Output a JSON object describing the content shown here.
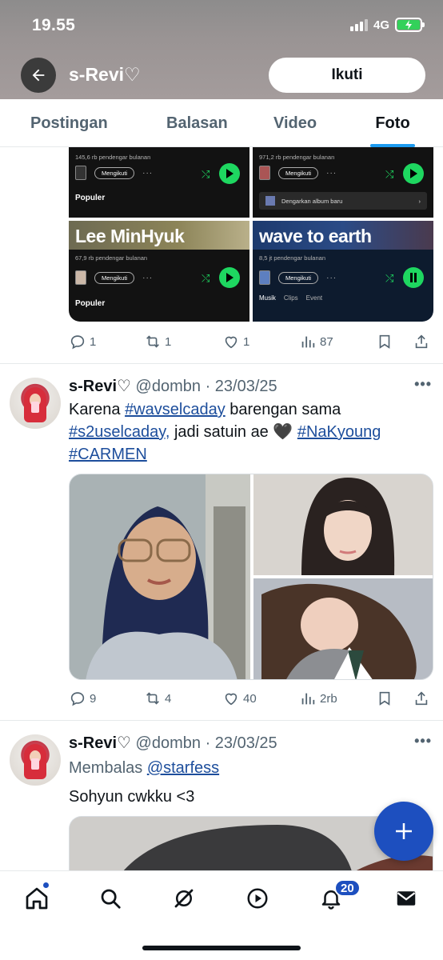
{
  "status_bar": {
    "time": "19.55",
    "network": "4G"
  },
  "header": {
    "profile_name": "s-Revi♡",
    "follow_label": "Ikuti"
  },
  "tabs": [
    {
      "label": "Postingan",
      "active": false
    },
    {
      "label": "Balasan",
      "active": false
    },
    {
      "label": "Video",
      "active": false
    },
    {
      "label": "Foto",
      "active": true
    }
  ],
  "post_1": {
    "spotify_cards": [
      {
        "artist": "",
        "listeners": "145,6 rb pendengar bulanan",
        "follow": "Mengikuti",
        "section": "Populer"
      },
      {
        "artist": "",
        "listeners": "971,2 rb pendengar bulanan",
        "follow": "Mengikuti",
        "album_row": "Dengarkan album baru"
      },
      {
        "artist": "Lee MinHyuk",
        "listeners": "67,9 rb pendengar bulanan",
        "follow": "Mengikuti",
        "section": "Populer"
      },
      {
        "artist": "wave to earth",
        "listeners": "8,5 jt pendengar bulanan",
        "follow": "Mengikuti",
        "tabs": [
          "Musik",
          "Clips",
          "Event"
        ]
      }
    ],
    "actions": {
      "replies": "1",
      "reposts": "1",
      "likes": "1",
      "views": "87"
    }
  },
  "post_2": {
    "name": "s-Revi♡",
    "handle": "@dombn",
    "date": "23/03/25",
    "text_1": "Karena ",
    "tag_1": "#wavselcaday",
    "text_2": " barengan sama",
    "tag_2": "#s2uselcaday,",
    "text_3": " jadi satuin ae 🖤 ",
    "tag_3": "#NaKyoung",
    "tag_4": "#CARMEN",
    "actions": {
      "replies": "9",
      "reposts": "4",
      "likes": "40",
      "views": "2rb"
    }
  },
  "post_3": {
    "name": "s-Revi♡",
    "handle": "@dombn",
    "date": "23/03/25",
    "reply_prefix": "Membalas ",
    "reply_to": "@starfess",
    "text": "Sohyun cwkku <3"
  },
  "bottom_nav": {
    "notifications_badge": "20"
  },
  "colors": {
    "accent": "#1d9bf0",
    "link": "#1d4e9c",
    "fab": "#1d4fbf",
    "spotify_green": "#1ed760"
  }
}
